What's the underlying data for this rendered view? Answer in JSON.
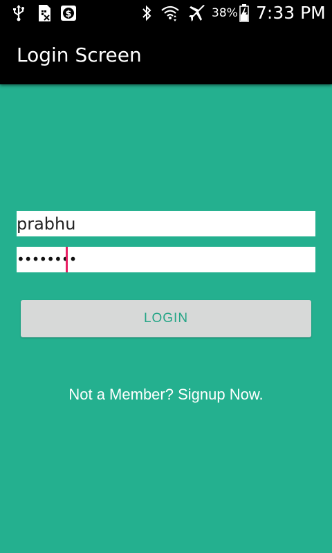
{
  "status_bar": {
    "icons": [
      "usb-icon",
      "sim-icon",
      "money-app-icon",
      "bluetooth-icon",
      "wifi-icon",
      "airplane-icon",
      "battery-icon"
    ],
    "battery_percent": "38%",
    "time": "7:33 PM"
  },
  "app_bar": {
    "title": "Login Screen"
  },
  "form": {
    "username_value": "prabhu",
    "password_value": "••••••••",
    "login_label": "LOGIN",
    "signup_text": "Not a Member? Signup Now."
  },
  "colors": {
    "background": "#24b08f",
    "button_bg": "#d7d9d8",
    "button_text": "#24a586",
    "cursor": "#e91e63"
  }
}
